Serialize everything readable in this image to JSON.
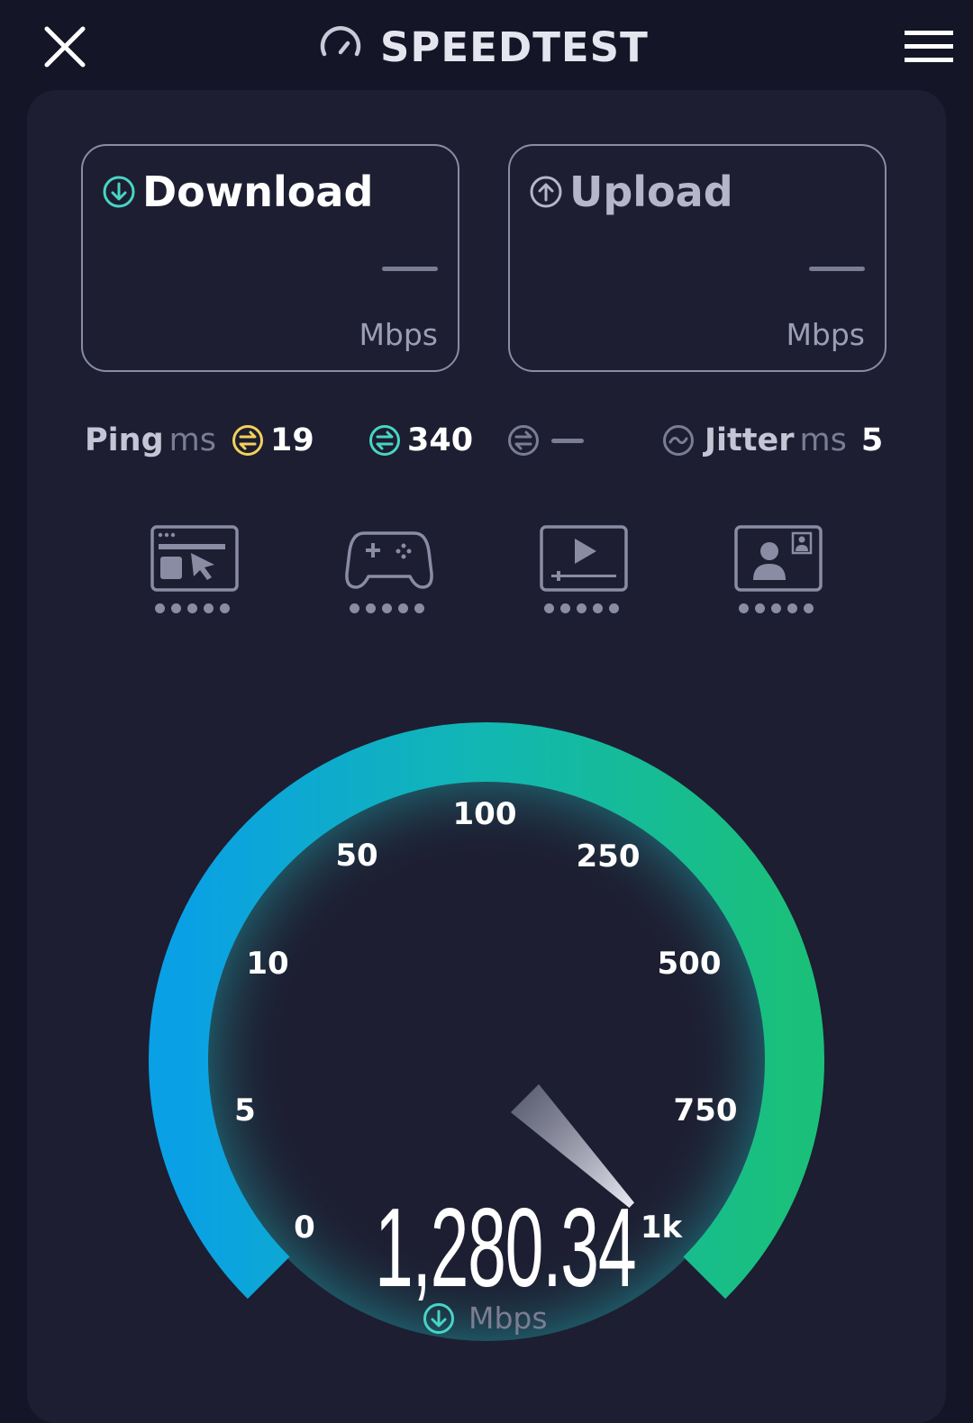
{
  "app": {
    "title": "SPEEDTEST"
  },
  "download": {
    "label": "Download",
    "value": "—",
    "unit": "Mbps"
  },
  "upload": {
    "label": "Upload",
    "value": "—",
    "unit": "Mbps"
  },
  "ping": {
    "label": "Ping",
    "unit": "ms",
    "idle": "19",
    "download": "340",
    "upload": "—"
  },
  "jitter": {
    "label": "Jitter",
    "unit": "ms",
    "value": "5"
  },
  "categories": [
    {
      "name": "web-browsing",
      "icon": "browser-cursor-icon",
      "rating": 5
    },
    {
      "name": "gaming",
      "icon": "gamepad-icon",
      "rating": 5
    },
    {
      "name": "video-streaming",
      "icon": "video-player-icon",
      "rating": 5
    },
    {
      "name": "video-chat",
      "icon": "video-call-icon",
      "rating": 5
    }
  ],
  "gauge": {
    "ticks": [
      "0",
      "5",
      "10",
      "50",
      "100",
      "250",
      "500",
      "750",
      "1k"
    ],
    "value": "1,280.34",
    "unit": "Mbps",
    "needle_level": 1.0,
    "colors": {
      "start": "#0aa0e6",
      "mid": "#12b7b2",
      "end": "#1ac07a"
    }
  },
  "colors": {
    "background": "#141526",
    "card": "#1d1e31",
    "download_accent": "#48d5c5",
    "ping_idle": "#f3d15a",
    "ping_download": "#48d5c5",
    "muted": "#7b7d93"
  }
}
